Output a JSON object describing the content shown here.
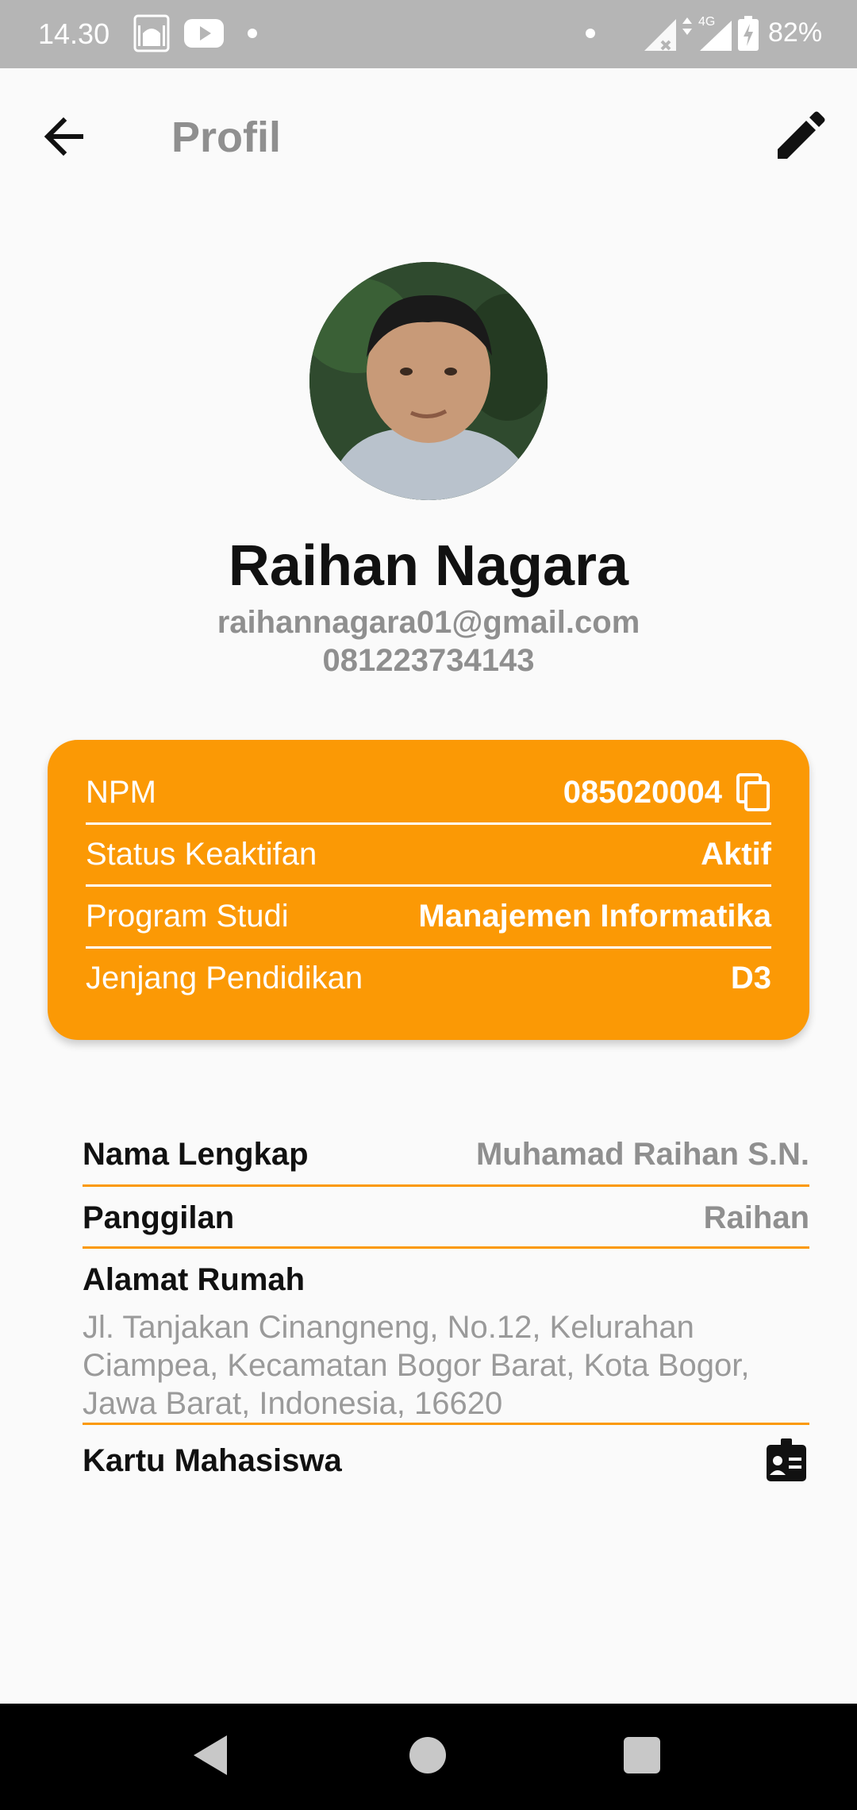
{
  "status_bar": {
    "time": "14.30",
    "network": "4G",
    "battery": "82%",
    "icons": [
      "mosque-icon",
      "youtube-icon",
      "dot-icon",
      "signal-off-icon",
      "signal-4g-icon",
      "battery-charging-icon"
    ]
  },
  "app_bar": {
    "title": "Profil",
    "back_icon": "arrow-left-icon",
    "edit_icon": "pencil-icon"
  },
  "profile": {
    "name": "Raihan Nagara",
    "email": "raihannagara01@gmail.com",
    "phone": "081223734143"
  },
  "academic_card": {
    "color": "#fb9905",
    "rows": [
      {
        "label": "NPM",
        "value": "085020004"
      },
      {
        "label": "Status Keaktifan",
        "value": "Aktif"
      },
      {
        "label": "Program Studi",
        "value": "Manajemen Informatika"
      },
      {
        "label": "Jenjang Pendidikan",
        "value": "D3"
      }
    ]
  },
  "details": {
    "full_name": {
      "label": "Nama Lengkap",
      "value": "Muhamad Raihan S.N."
    },
    "nickname": {
      "label": "Panggilan",
      "value": "Raihan"
    },
    "address": {
      "label": "Alamat Rumah",
      "value": "Jl. Tanjakan Cinangneng, No.12, Kelurahan Ciampea, Kecamatan Bogor Barat, Kota Bogor, Jawa Barat, Indonesia, 16620"
    },
    "student_card": {
      "label": "Kartu Mahasiswa",
      "icon": "id-card-icon"
    }
  },
  "accent_color": "#fb9905"
}
